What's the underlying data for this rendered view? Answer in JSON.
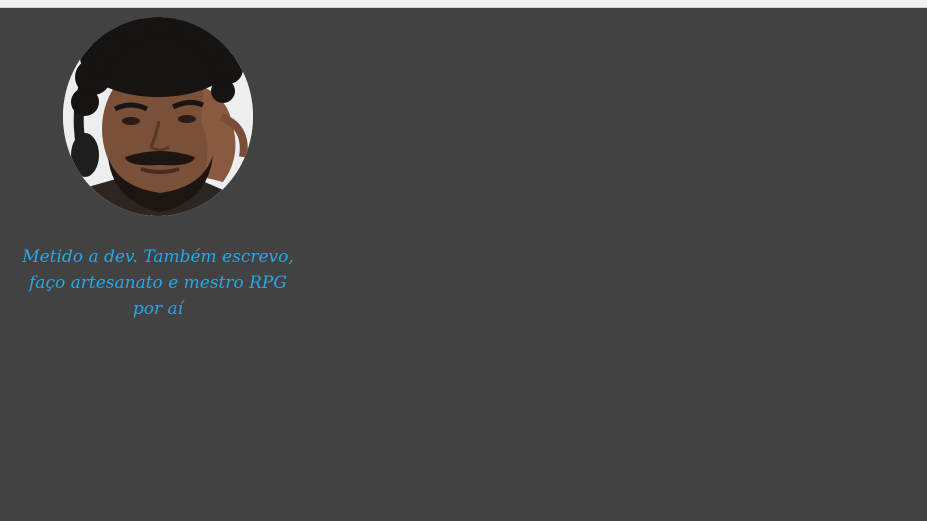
{
  "profile": {
    "bio": "Metido a dev. Também escrevo, faço artesanato e mestro RPG por aí"
  },
  "colors": {
    "background": "#424242",
    "accent_text": "#29a7e6",
    "top_bar": "#f1f1f1"
  }
}
